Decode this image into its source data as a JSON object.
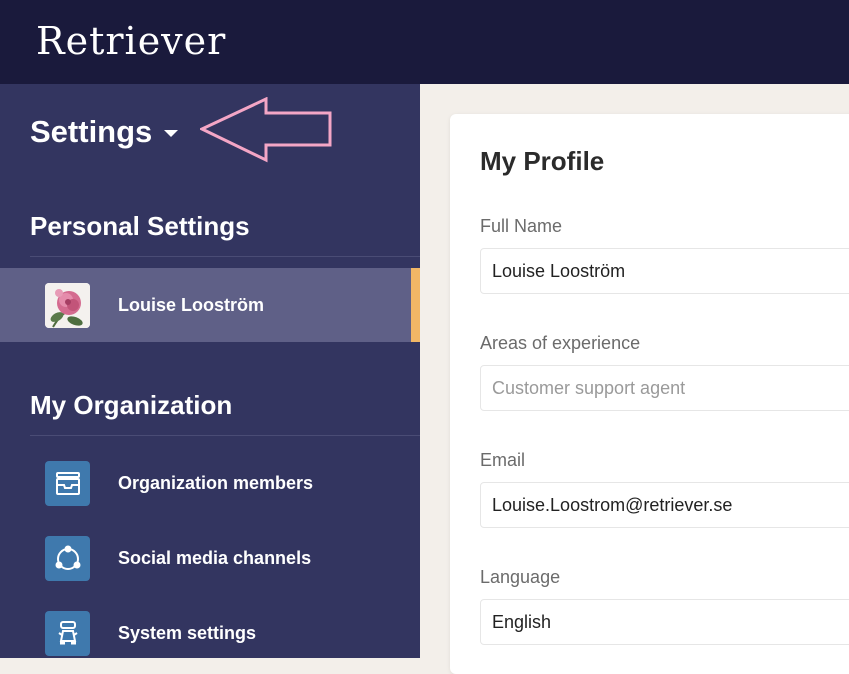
{
  "header": {
    "brand": "Retriever"
  },
  "sidebar": {
    "settings_label": "Settings",
    "personal_heading": "Personal Settings",
    "personal_items": [
      {
        "label": "Louise Looström",
        "icon": "avatar-rose-photo"
      }
    ],
    "org_heading": "My Organization",
    "org_items": [
      {
        "label": "Organization members",
        "icon": "inbox-tray-icon"
      },
      {
        "label": "Social media channels",
        "icon": "network-nodes-icon"
      },
      {
        "label": "System settings",
        "icon": "robot-icon"
      }
    ]
  },
  "profile": {
    "title": "My Profile",
    "full_name_label": "Full Name",
    "full_name_value": "Louise Looström",
    "areas_label": "Areas of experience",
    "areas_placeholder": "Customer support agent",
    "email_label": "Email",
    "email_value": "Louise.Loostrom@retriever.se",
    "language_label": "Language",
    "language_value": "English"
  },
  "colors": {
    "topbar": "#1a1a3c",
    "sidebar": "#333560",
    "active_item": "#5f6087",
    "accent": "#f2b766",
    "icon_tile": "#3f79ad",
    "annotation_arrow": "#f4a6c6"
  }
}
